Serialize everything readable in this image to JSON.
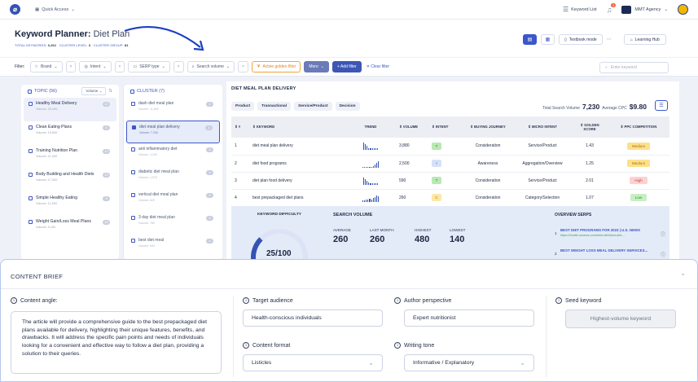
{
  "topbar": {
    "logo": "⌀",
    "quick_access": "Quick Access",
    "keyword_list": "Keyword List",
    "notif_count": "2",
    "agency": "MMT Agency"
  },
  "header": {
    "title_bold": "Keyword Planner:",
    "title_rest": "Diet Plan",
    "stats": [
      {
        "label": "TOTAL KEYWORDS:",
        "value": "3,261"
      },
      {
        "label": "CLUSTER LEVEL:",
        "value": "3"
      },
      {
        "label": "CLUSTER GROUP:",
        "value": "81"
      }
    ],
    "textbook_mode": "Textbook mode",
    "learning_hub": "Learning Hub"
  },
  "filters": {
    "label": "Filter:",
    "brand": "Brand",
    "intent": "Intent",
    "serp_type": "SERP type",
    "search_volume": "Search volume",
    "active_golden": "Active golden filter",
    "more": "More",
    "add_filter": "+ Add filter",
    "clear_filter": "Clear filter",
    "search_placeholder": "Enter keyword"
  },
  "topics": {
    "header": "TOPIC (56)",
    "sort_label": "Volume",
    "items": [
      {
        "name": "Healthy Meal Delivery",
        "volume": "Volume: 29,100",
        "count": "12"
      },
      {
        "name": "Clean Eating Plans",
        "volume": "Volume: 19,600",
        "count": "8"
      },
      {
        "name": "Training Nutrition Plan",
        "volume": "Volume: 11,000",
        "count": "10"
      },
      {
        "name": "Body Building and Health Diets",
        "volume": "Volume: 17,000",
        "count": "12"
      },
      {
        "name": "Simple Healthy Eating",
        "volume": "Volume: 11,500",
        "count": "8"
      },
      {
        "name": "Weight Gain/Loss Meal Plans",
        "volume": "Volume: 9,100",
        "count": "10"
      }
    ]
  },
  "clusters": {
    "header": "CLUSTER (7)",
    "items": [
      {
        "name": "dash diet meal plan",
        "volume": "Volume: 11,600",
        "count": "4"
      },
      {
        "name": "diet meal plan delivery",
        "volume": "Volume: 7,230",
        "count": "4"
      },
      {
        "name": "anti inflammatory diet",
        "volume": "Volume: 4,340",
        "count": "4"
      },
      {
        "name": "diabetic diet meal plan",
        "volume": "Volume: 1,570",
        "count": "4"
      },
      {
        "name": "vertical diet meal plan",
        "volume": "Volume: 820",
        "count": "4"
      },
      {
        "name": "3 day diet meal plan",
        "volume": "Volume: 780",
        "count": "4"
      },
      {
        "name": "best diet meal",
        "volume": "Volume: 640",
        "count": "4"
      }
    ]
  },
  "main": {
    "title": "DIET MEAL PLAN DELIVERY",
    "tabs": [
      "Product",
      "Transactional",
      "Service/Product",
      "Decision"
    ],
    "total_label": "Total Search Volume",
    "total_value": "7,230",
    "cpc_label": "Average CPC",
    "cpc_value": "$9.80",
    "columns": [
      "#",
      "KEYWORD",
      "TREND",
      "VOLUME",
      "INTENT",
      "BUYING JOURNEY",
      "MICRO INTENT",
      "GOLDEN SCORE",
      "PPC COMPETITION"
    ],
    "rows": [
      {
        "n": "1",
        "keyword": "diet meal plan delivery",
        "trend": [
          9,
          7,
          5,
          2,
          2,
          2,
          2,
          2,
          2
        ],
        "volume": "3,880",
        "intent": "T",
        "intent_type": "t",
        "journey": "Consideration",
        "micro": "Service/Product",
        "score": "1.43",
        "ppc": "Medium",
        "ppc_type": "medium"
      },
      {
        "n": "2",
        "keyword": "diet food programs",
        "trend": [
          1,
          1,
          1,
          1,
          1,
          1,
          2,
          4,
          6,
          8
        ],
        "volume": "2,500",
        "intent": "I",
        "intent_type": "i",
        "journey": "Awareness",
        "micro": "Aggregation/Overview",
        "score": "1.25",
        "ppc": "Medium",
        "ppc_type": "medium"
      },
      {
        "n": "3",
        "keyword": "diet plan food delivery",
        "trend": [
          9,
          7,
          5,
          3,
          2,
          2,
          2,
          2,
          2
        ],
        "volume": "590",
        "intent": "T",
        "intent_type": "t",
        "journey": "Consideration",
        "micro": "Service/Product",
        "score": "2.01",
        "ppc": "High",
        "ppc_type": "high"
      },
      {
        "n": "4",
        "keyword": "best prepackaged diet plans",
        "trend": [
          2,
          2,
          3,
          3,
          4,
          3,
          5,
          6,
          8,
          7
        ],
        "volume": "260",
        "intent": "C",
        "intent_type": "c",
        "journey": "Consideration",
        "micro": "Category/Selection",
        "score": "1.07",
        "ppc": "Low",
        "ppc_type": "low"
      }
    ]
  },
  "overview": {
    "kd_label": "KEYWORD DIFFICULTY",
    "kd_value": "25/100",
    "kd_fraction": 0.25,
    "sv_label": "SEARCH VOLUME",
    "sv": [
      {
        "label": "AVERAGE",
        "value": "260"
      },
      {
        "label": "LAST MONTH",
        "value": "260"
      },
      {
        "label": "HIGHEST",
        "value": "480"
      },
      {
        "label": "LOWEST",
        "value": "140"
      }
    ],
    "serps_label": "OVERVIEW SERPS",
    "serps": [
      {
        "n": "1",
        "title": "BEST DIET PROGRAMS FOR 2023 | U.S. NEWS",
        "url": "https://health.usnews.com/best-diet/best-diet-..."
      },
      {
        "n": "2",
        "title": "BEST WEIGHT LOSS MEAL DELIVERY SERVICES...",
        "url": ""
      }
    ]
  },
  "brief": {
    "title": "CONTENT BRIEF",
    "angle_label": "Content angle:",
    "angle_text": "The article will provide a comprehensive guide to the best prepackaged diet plans available for delivery, highlighting their unique features, benefits, and drawbacks. It will address the specific pain points and needs of individuals looking for a convenient and effective way to follow a diet plan, providing a solution to their queries.",
    "audience_label": "Target audience",
    "audience_value": "Health-conscious individuals",
    "format_label": "Content format",
    "format_value": "Listicles",
    "author_label": "Author perspective",
    "author_value": "Expert nutritionist",
    "tone_label": "Writing tone",
    "tone_value": "Informative / Explanatory",
    "seed_label": "Seed keyword",
    "seed_value": "Highest-volume keyword"
  }
}
